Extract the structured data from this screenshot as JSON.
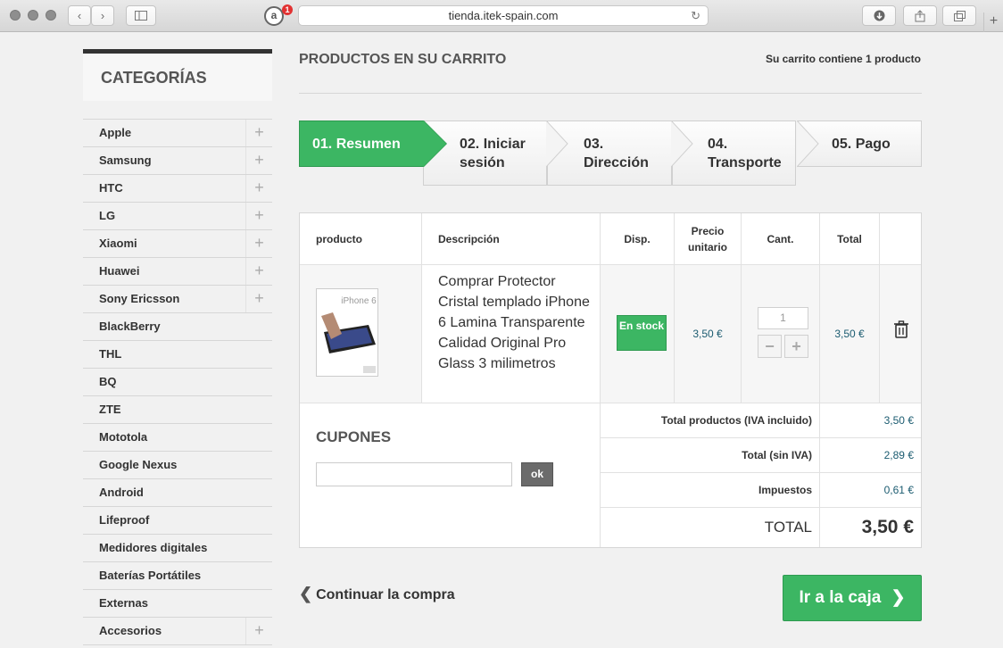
{
  "browser": {
    "url": "tienda.itek-spain.com",
    "extension_badge": "1"
  },
  "sidebar": {
    "title": "CATEGORÍAS",
    "items": [
      {
        "label": "Apple",
        "expandable": true
      },
      {
        "label": "Samsung",
        "expandable": true
      },
      {
        "label": "HTC",
        "expandable": true
      },
      {
        "label": "LG",
        "expandable": true
      },
      {
        "label": "Xiaomi",
        "expandable": true
      },
      {
        "label": "Huawei",
        "expandable": true
      },
      {
        "label": "Sony Ericsson",
        "expandable": true
      },
      {
        "label": "BlackBerry",
        "expandable": false
      },
      {
        "label": "THL",
        "expandable": false
      },
      {
        "label": "BQ",
        "expandable": false
      },
      {
        "label": "ZTE",
        "expandable": false
      },
      {
        "label": "Mototola",
        "expandable": false
      },
      {
        "label": "Google Nexus",
        "expandable": false
      },
      {
        "label": "Android",
        "expandable": false
      },
      {
        "label": "Lifeproof",
        "expandable": false
      },
      {
        "label": "Medidores digitales",
        "expandable": false
      },
      {
        "label": "Baterías Portátiles",
        "expandable": false
      },
      {
        "label": "Externas",
        "expandable": false
      },
      {
        "label": "Accesorios",
        "expandable": true
      }
    ]
  },
  "main": {
    "title": "PRODUCTOS EN SU CARRITO",
    "cart_summary": "Su carrito contiene 1 producto"
  },
  "steps": [
    {
      "label": "01. Resumen",
      "active": true
    },
    {
      "label": "02. Iniciar sesión",
      "active": false
    },
    {
      "label": "03. Dirección",
      "active": false
    },
    {
      "label": "04. Transporte",
      "active": false
    },
    {
      "label": "05. Pago",
      "active": false
    }
  ],
  "table": {
    "headers": {
      "product": "producto",
      "description": "Descripción",
      "availability": "Disp.",
      "unit_price": "Precio unitario",
      "quantity": "Cant.",
      "total": "Total"
    },
    "item": {
      "image_text": "iPhone 6",
      "description": "Comprar Protector Cristal templado iPhone 6 Lamina Transparente Calidad Original Pro Glass 3 milimetros",
      "availability": "En stock",
      "unit_price": "3,50 €",
      "quantity": "1",
      "total": "3,50 €"
    }
  },
  "coupons": {
    "title": "CUPONES",
    "input_value": "",
    "button": "ok"
  },
  "summary": [
    {
      "label": "Total productos (IVA incluido)",
      "value": "3,50 €"
    },
    {
      "label": "Total (sin IVA)",
      "value": "2,89 €"
    },
    {
      "label": "Impuestos",
      "value": "0,61 €"
    }
  ],
  "grand_total": {
    "label": "TOTAL",
    "value": "3,50 €"
  },
  "actions": {
    "continue": "Continuar la compra",
    "checkout": "Ir a la caja"
  },
  "colors": {
    "accent_green": "#3cb663",
    "price_blue": "#1b5b70"
  }
}
